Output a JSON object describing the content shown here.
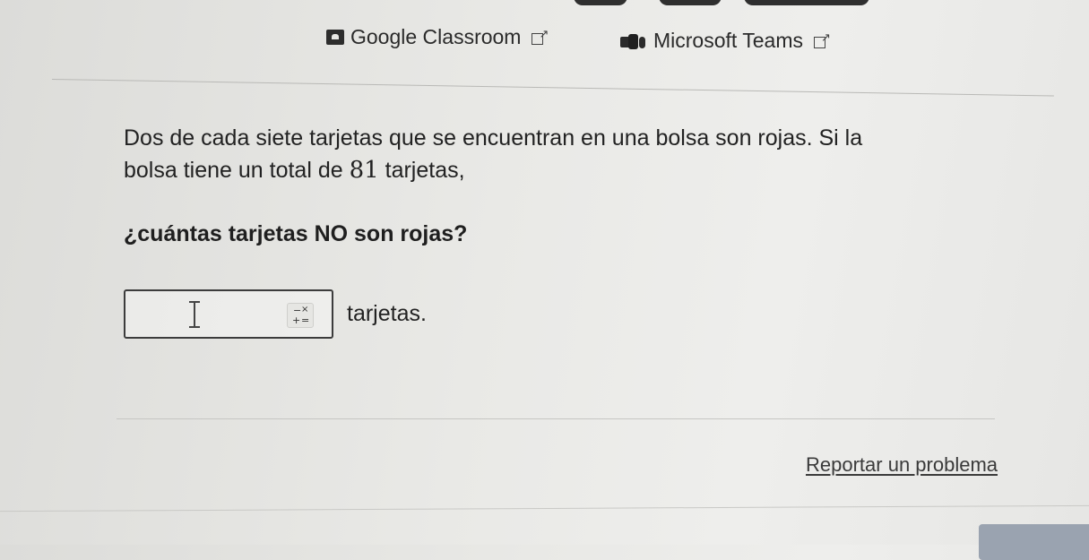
{
  "share": {
    "google_classroom": "Google Classroom",
    "microsoft_teams": "Microsoft Teams"
  },
  "question": {
    "line1": "Dos de cada siete tarjetas que se encuentran en una bolsa son rojas. Si la",
    "line2_prefix": "bolsa tiene un total de ",
    "total": "81",
    "line2_suffix": " tarjetas,",
    "prompt": "¿cuántas tarjetas NO son rojas?"
  },
  "answer": {
    "value": "",
    "unit": "tarjetas."
  },
  "footer": {
    "report_problem": "Reportar un problema"
  },
  "icons": {
    "google_classroom": "google-classroom-icon",
    "microsoft_teams": "microsoft-teams-icon",
    "external_link": "external-link-icon",
    "text_cursor": "text-cursor-icon",
    "math_keypad": "math-keypad-icon"
  }
}
